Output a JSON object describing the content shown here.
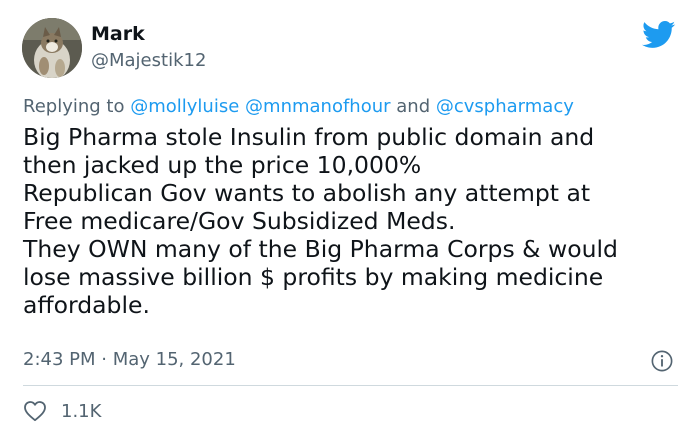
{
  "tweet": {
    "author_name": "Mark",
    "author_handle": "@Majestik12",
    "reply_prefix": "Replying to",
    "reply_mentions": [
      "@mollyluise",
      "@mnmanofhour",
      "@cvspharmacy"
    ],
    "reply_conjunction": "and",
    "text": "Big Pharma stole Insulin from public domain and\nthen jacked up the price 10,000%\nRepublican Gov wants to abolish any attempt at\nFree medicare/Gov Subsidized Meds.\nThey OWN many of the Big Pharma Corps & would\nlose massive billion $ profits by making medicine\naffordable.",
    "timestamp": "2:43 PM · May 15, 2021",
    "like_count": "1.1K"
  },
  "icons": {
    "brand": "twitter-bird-icon",
    "info": "info-icon",
    "like": "heart-icon"
  },
  "colors": {
    "brand_blue": "#1d9bf0",
    "secondary_text": "#536471",
    "divider": "#cfd9de"
  }
}
